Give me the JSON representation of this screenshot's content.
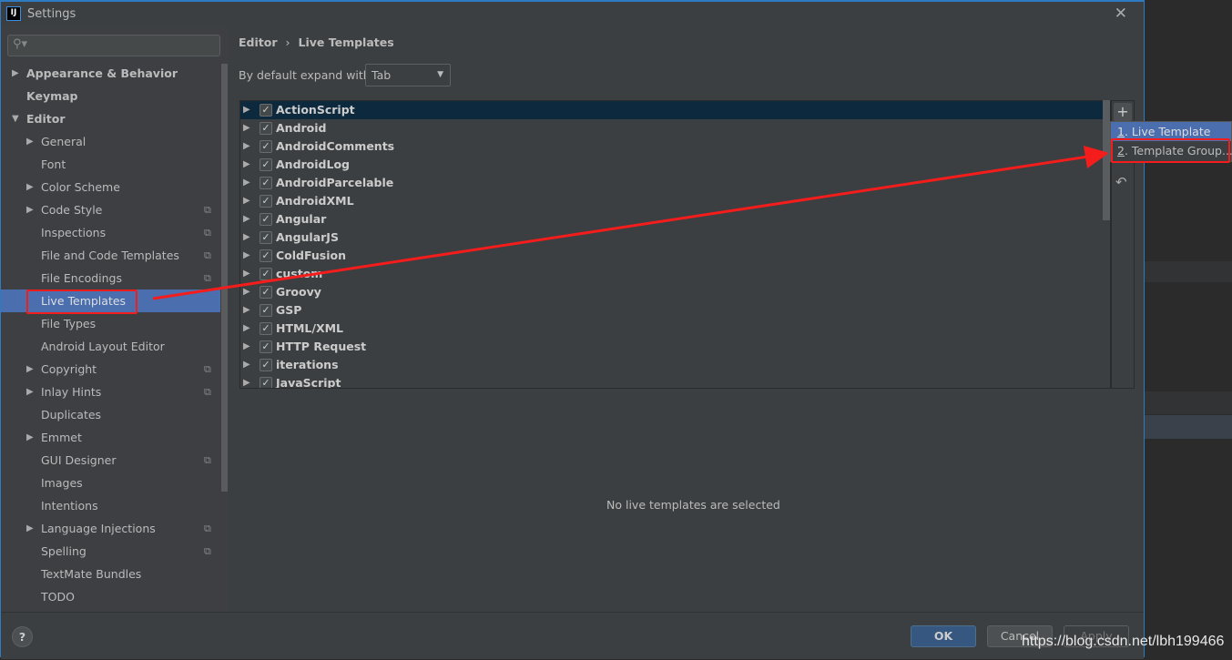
{
  "window": {
    "title": "Settings",
    "app_icon": "IJ"
  },
  "search": {
    "placeholder": ""
  },
  "sidebar": {
    "items": [
      {
        "label": "Appearance & Behavior",
        "level": 0,
        "arrow": "collapsed",
        "bold": true
      },
      {
        "label": "Keymap",
        "level": 0,
        "arrow": "none",
        "bold": true
      },
      {
        "label": "Editor",
        "level": 0,
        "arrow": "expanded",
        "bold": true
      },
      {
        "label": "General",
        "level": 1,
        "arrow": "collapsed"
      },
      {
        "label": "Font",
        "level": 1,
        "arrow": "none"
      },
      {
        "label": "Color Scheme",
        "level": 1,
        "arrow": "collapsed"
      },
      {
        "label": "Code Style",
        "level": 1,
        "arrow": "collapsed",
        "copy": true
      },
      {
        "label": "Inspections",
        "level": 1,
        "arrow": "none",
        "copy": true
      },
      {
        "label": "File and Code Templates",
        "level": 1,
        "arrow": "none",
        "copy": true
      },
      {
        "label": "File Encodings",
        "level": 1,
        "arrow": "none",
        "copy": true
      },
      {
        "label": "Live Templates",
        "level": 1,
        "arrow": "none",
        "selected": true
      },
      {
        "label": "File Types",
        "level": 1,
        "arrow": "none"
      },
      {
        "label": "Android Layout Editor",
        "level": 1,
        "arrow": "none"
      },
      {
        "label": "Copyright",
        "level": 1,
        "arrow": "collapsed",
        "copy": true
      },
      {
        "label": "Inlay Hints",
        "level": 1,
        "arrow": "collapsed",
        "copy": true
      },
      {
        "label": "Duplicates",
        "level": 1,
        "arrow": "none"
      },
      {
        "label": "Emmet",
        "level": 1,
        "arrow": "collapsed"
      },
      {
        "label": "GUI Designer",
        "level": 1,
        "arrow": "none",
        "copy": true
      },
      {
        "label": "Images",
        "level": 1,
        "arrow": "none"
      },
      {
        "label": "Intentions",
        "level": 1,
        "arrow": "none"
      },
      {
        "label": "Language Injections",
        "level": 1,
        "arrow": "collapsed",
        "copy": true
      },
      {
        "label": "Spelling",
        "level": 1,
        "arrow": "none",
        "copy": true
      },
      {
        "label": "TextMate Bundles",
        "level": 1,
        "arrow": "none"
      },
      {
        "label": "TODO",
        "level": 1,
        "arrow": "none"
      }
    ]
  },
  "breadcrumb": {
    "parent": "Editor",
    "separator": "›",
    "current": "Live Templates"
  },
  "expand": {
    "label": "By default expand with",
    "value": "Tab"
  },
  "templates": [
    {
      "label": "ActionScript",
      "checked": true,
      "selected": true
    },
    {
      "label": "Android",
      "checked": true
    },
    {
      "label": "AndroidComments",
      "checked": true
    },
    {
      "label": "AndroidLog",
      "checked": true
    },
    {
      "label": "AndroidParcelable",
      "checked": true
    },
    {
      "label": "AndroidXML",
      "checked": true
    },
    {
      "label": "Angular",
      "checked": true
    },
    {
      "label": "AngularJS",
      "checked": true
    },
    {
      "label": "ColdFusion",
      "checked": true
    },
    {
      "label": "custom",
      "checked": true
    },
    {
      "label": "Groovy",
      "checked": true
    },
    {
      "label": "GSP",
      "checked": true
    },
    {
      "label": "HTML/XML",
      "checked": true
    },
    {
      "label": "HTTP Request",
      "checked": true
    },
    {
      "label": "iterations",
      "checked": true
    },
    {
      "label": "JavaScript",
      "checked": true
    }
  ],
  "toolbar": {
    "add": "+",
    "undo": "↶"
  },
  "popup": {
    "items": [
      {
        "mnemonic": "1",
        "label": ". Live Template",
        "selected": true
      },
      {
        "mnemonic": "2",
        "label": ". Template Group..."
      }
    ]
  },
  "empty_message": "No live templates are selected",
  "footer": {
    "help": "?",
    "ok": "OK",
    "cancel": "Cancel",
    "apply": "Apply"
  },
  "watermark": "https://blog.csdn.net/lbh199466",
  "colors": {
    "selection": "#4b6eaf",
    "annotation": "#f51c1c",
    "ok_button": "#365880"
  }
}
